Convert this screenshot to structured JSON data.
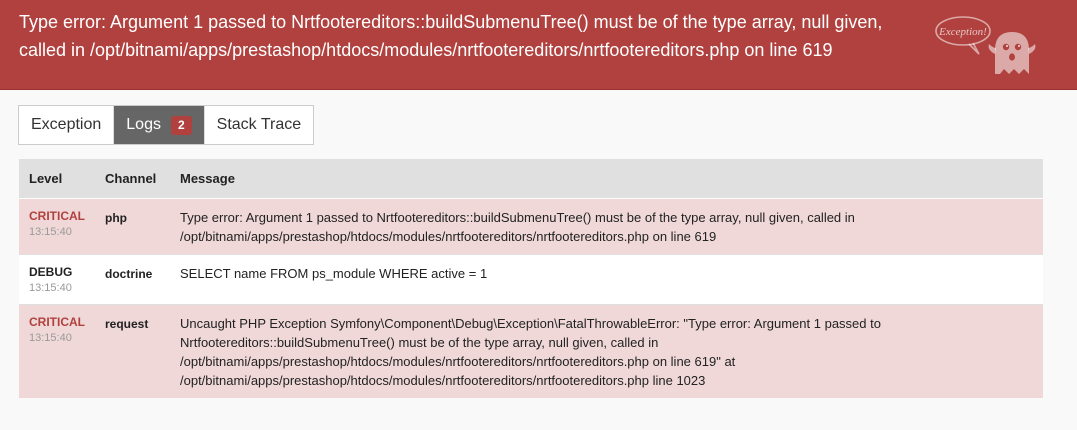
{
  "header": {
    "title": "Type error: Argument 1 passed to Nrtfootereditors::buildSubmenuTree() must be of the type array, null given, called in /opt/bitnami/apps/prestashop/htdocs/modules/nrtfootereditors/nrtfootereditors.php on line 619",
    "ghost_text": "Exception!",
    "bg_color": "#b0413e",
    "icon": "ghost-icon"
  },
  "tabs": [
    {
      "label": "Exception",
      "active": false
    },
    {
      "label": "Logs",
      "active": true,
      "badge": "2"
    },
    {
      "label": "Stack Trace",
      "active": false
    }
  ],
  "logs": {
    "columns": [
      "Level",
      "Channel",
      "Message"
    ],
    "rows": [
      {
        "level": "CRITICAL",
        "time": "13:15:40",
        "channel": "php",
        "message": "Type error: Argument 1 passed to Nrtfootereditors::buildSubmenuTree() must be of the type array, null given, called in /opt/bitnami/apps/prestashop/htdocs/modules/nrtfootereditors/nrtfootereditors.php on line 619"
      },
      {
        "level": "DEBUG",
        "time": "13:15:40",
        "channel": "doctrine",
        "message": "SELECT name FROM ps_module WHERE active = 1"
      },
      {
        "level": "CRITICAL",
        "time": "13:15:40",
        "channel": "request",
        "message": "Uncaught PHP Exception Symfony\\Component\\Debug\\Exception\\FatalThrowableError: \"Type error: Argument 1 passed to Nrtfootereditors::buildSubmenuTree() must be of the type array, null given, called in /opt/bitnami/apps/prestashop/htdocs/modules/nrtfootereditors/nrtfootereditors.php on line 619\" at /opt/bitnami/apps/prestashop/htdocs/modules/nrtfootereditors/nrtfootereditors.php line 1023"
      }
    ]
  },
  "colors": {
    "critical": "#b0413e",
    "critical_row_bg": "#f0d8d8",
    "tab_active_bg": "#666666"
  }
}
